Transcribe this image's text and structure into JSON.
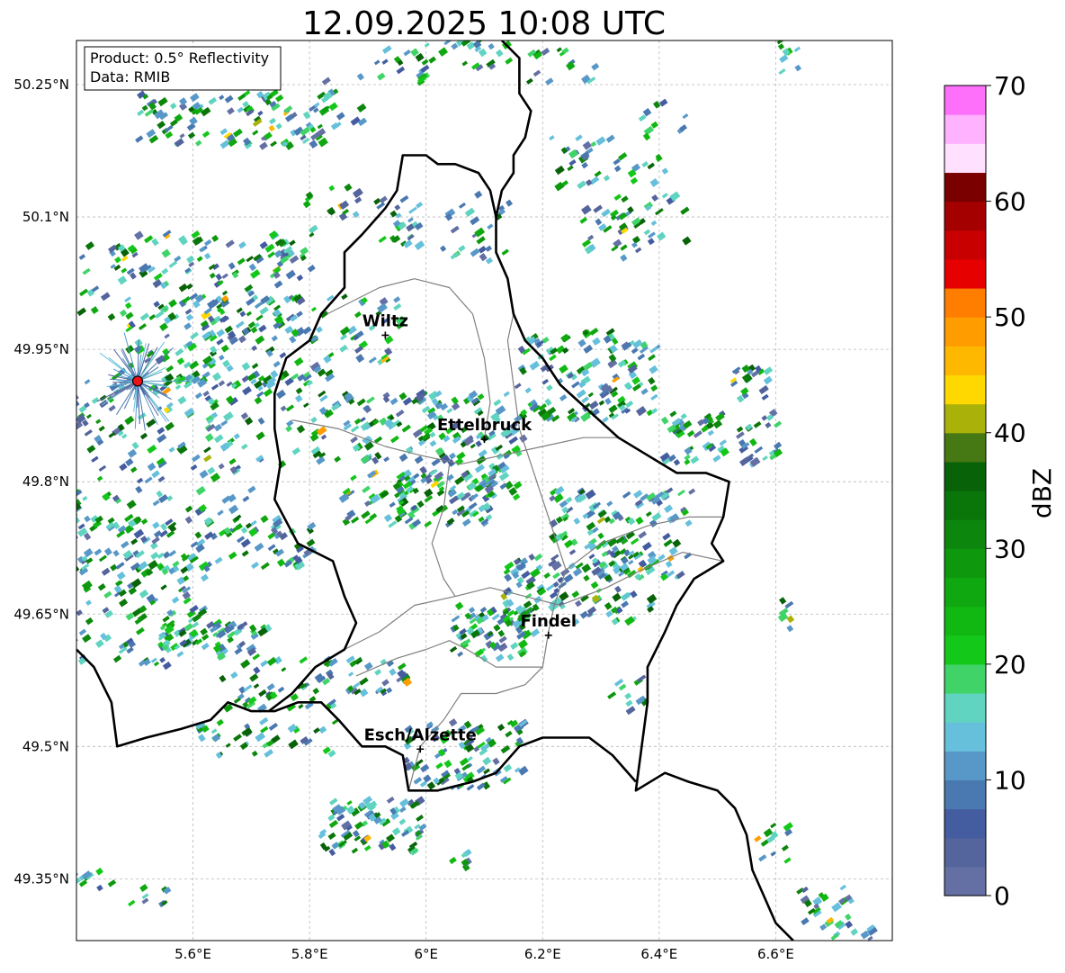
{
  "title": "12.09.2025 10:08 UTC",
  "info_box": {
    "product": "Product: 0.5° Reflectivity",
    "data": "Data: RMIB"
  },
  "map_extent": {
    "lon_min": 5.4,
    "lon_max": 6.8,
    "lat_min": 49.28,
    "lat_max": 50.3
  },
  "lon_ticks": [
    {
      "value": 5.6,
      "label": "5.6°E"
    },
    {
      "value": 5.8,
      "label": "5.8°E"
    },
    {
      "value": 6.0,
      "label": "6°E"
    },
    {
      "value": 6.2,
      "label": "6.2°E"
    },
    {
      "value": 6.4,
      "label": "6.4°E"
    },
    {
      "value": 6.6,
      "label": "6.6°E"
    }
  ],
  "lat_ticks": [
    {
      "value": 50.25,
      "label": "50.25°N"
    },
    {
      "value": 50.1,
      "label": "50.1°N"
    },
    {
      "value": 49.95,
      "label": "49.95°N"
    },
    {
      "value": 49.8,
      "label": "49.8°N"
    },
    {
      "value": 49.65,
      "label": "49.65°N"
    },
    {
      "value": 49.5,
      "label": "49.5°N"
    },
    {
      "value": 49.35,
      "label": "49.35°N"
    }
  ],
  "cities": [
    {
      "name": "Wiltz",
      "lon": 5.93,
      "lat": 49.966
    },
    {
      "name": "Ettelbruck",
      "lon": 6.1,
      "lat": 49.848
    },
    {
      "name": "Findel",
      "lon": 6.21,
      "lat": 49.626
    },
    {
      "name": "Esch/Alzette",
      "lon": 5.99,
      "lat": 49.497
    }
  ],
  "radar_site": {
    "lon": 5.505,
    "lat": 49.914,
    "color": "#e8141a"
  },
  "colorbar": {
    "label": "dBZ",
    "min": 0,
    "max": 70,
    "step": 2.5,
    "tick_labels": [
      "0",
      "10",
      "20",
      "30",
      "40",
      "50",
      "60",
      "70"
    ],
    "colors": [
      "#6470a4",
      "#54649c",
      "#445ca0",
      "#4a78b0",
      "#5898c8",
      "#66c0dc",
      "#60d4c0",
      "#40d468",
      "#14c81a",
      "#12b812",
      "#10a810",
      "#0e980e",
      "#0c860c",
      "#0a760a",
      "#086208",
      "#467814",
      "#aab20a",
      "#ffd800",
      "#ffb800",
      "#ff9c00",
      "#ff7e00",
      "#e60000",
      "#c80000",
      "#a40000",
      "#7a0000",
      "#ffe0ff",
      "#ffb2ff",
      "#ff70fa",
      "#ea36ea"
    ]
  },
  "borders": {
    "country": [
      [
        [
          6.13,
          50.3
        ],
        [
          6.16,
          50.28
        ],
        [
          6.16,
          50.24
        ],
        [
          6.18,
          50.22
        ],
        [
          6.17,
          50.19
        ],
        [
          6.15,
          50.17
        ],
        [
          6.15,
          50.15
        ],
        [
          6.13,
          50.13
        ],
        [
          6.12,
          50.1
        ],
        [
          6.12,
          50.06
        ],
        [
          6.14,
          50.03
        ],
        [
          6.15,
          49.99
        ],
        [
          6.17,
          49.96
        ],
        [
          6.2,
          49.94
        ],
        [
          6.23,
          49.91
        ],
        [
          6.28,
          49.88
        ],
        [
          6.33,
          49.85
        ],
        [
          6.38,
          49.83
        ],
        [
          6.43,
          49.81
        ],
        [
          6.48,
          49.81
        ],
        [
          6.52,
          49.8
        ],
        [
          6.51,
          49.76
        ],
        [
          6.49,
          49.73
        ],
        [
          6.51,
          49.71
        ],
        [
          6.46,
          49.69
        ],
        [
          6.43,
          49.66
        ],
        [
          6.41,
          49.63
        ],
        [
          6.38,
          49.59
        ],
        [
          6.38,
          49.55
        ],
        [
          6.37,
          49.5
        ],
        [
          6.36,
          49.45
        ],
        [
          6.41,
          49.47
        ],
        [
          6.45,
          49.46
        ],
        [
          6.5,
          49.45
        ],
        [
          6.53,
          49.43
        ],
        [
          6.55,
          49.4
        ],
        [
          6.56,
          49.36
        ],
        [
          6.58,
          49.33
        ],
        [
          6.6,
          49.3
        ],
        [
          6.63,
          49.28
        ]
      ],
      [
        [
          5.4,
          49.61
        ],
        [
          5.43,
          49.59
        ],
        [
          5.46,
          49.55
        ],
        [
          5.47,
          49.5
        ],
        [
          5.52,
          49.51
        ],
        [
          5.58,
          49.52
        ],
        [
          5.63,
          49.53
        ],
        [
          5.66,
          49.55
        ],
        [
          5.7,
          49.54
        ],
        [
          5.74,
          49.54
        ],
        [
          5.78,
          49.55
        ],
        [
          5.82,
          49.55
        ],
        [
          5.85,
          49.53
        ],
        [
          5.89,
          49.5
        ],
        [
          5.93,
          49.5
        ],
        [
          5.96,
          49.49
        ],
        [
          5.97,
          49.45
        ],
        [
          6.02,
          49.45
        ],
        [
          6.08,
          49.46
        ],
        [
          6.12,
          49.47
        ],
        [
          6.16,
          49.5
        ],
        [
          6.2,
          49.51
        ],
        [
          6.24,
          49.51
        ],
        [
          6.28,
          49.51
        ],
        [
          6.32,
          49.49
        ],
        [
          6.36,
          49.46
        ]
      ],
      [
        [
          5.73,
          49.54
        ],
        [
          5.77,
          49.56
        ],
        [
          5.81,
          49.59
        ],
        [
          5.86,
          49.61
        ],
        [
          5.88,
          49.64
        ],
        [
          5.86,
          49.67
        ],
        [
          5.84,
          49.71
        ],
        [
          5.78,
          49.73
        ],
        [
          5.74,
          49.78
        ],
        [
          5.75,
          49.82
        ],
        [
          5.74,
          49.86
        ],
        [
          5.74,
          49.9
        ],
        [
          5.76,
          49.94
        ],
        [
          5.8,
          49.96
        ],
        [
          5.82,
          49.99
        ],
        [
          5.86,
          50.02
        ],
        [
          5.86,
          50.06
        ],
        [
          5.89,
          50.08
        ],
        [
          5.93,
          50.11
        ],
        [
          5.95,
          50.13
        ],
        [
          5.96,
          50.17
        ],
        [
          6.0,
          50.17
        ],
        [
          6.02,
          50.16
        ],
        [
          6.05,
          50.16
        ],
        [
          6.09,
          50.15
        ],
        [
          6.11,
          50.13
        ],
        [
          6.12,
          50.1
        ]
      ]
    ],
    "canton": [
      [
        [
          5.97,
          49.45
        ],
        [
          5.99,
          49.5
        ],
        [
          6.03,
          49.53
        ],
        [
          6.06,
          49.56
        ],
        [
          6.12,
          49.56
        ],
        [
          6.17,
          49.57
        ],
        [
          6.2,
          49.59
        ],
        [
          6.21,
          49.63
        ],
        [
          6.22,
          49.66
        ],
        [
          6.24,
          49.7
        ],
        [
          6.22,
          49.74
        ],
        [
          6.19,
          49.8
        ],
        [
          6.16,
          49.86
        ],
        [
          6.15,
          49.91
        ],
        [
          6.14,
          49.96
        ],
        [
          6.15,
          49.99
        ]
      ],
      [
        [
          5.86,
          49.61
        ],
        [
          5.92,
          49.63
        ],
        [
          5.98,
          49.66
        ],
        [
          6.05,
          49.67
        ],
        [
          6.11,
          49.68
        ],
        [
          6.17,
          49.67
        ],
        [
          6.23,
          49.66
        ],
        [
          6.31,
          49.68
        ],
        [
          6.37,
          49.7
        ],
        [
          6.44,
          49.72
        ],
        [
          6.51,
          49.71
        ]
      ],
      [
        [
          5.77,
          49.87
        ],
        [
          5.85,
          49.86
        ],
        [
          5.93,
          49.84
        ],
        [
          5.99,
          49.83
        ],
        [
          6.06,
          49.82
        ],
        [
          6.13,
          49.83
        ],
        [
          6.2,
          49.84
        ],
        [
          6.27,
          49.85
        ],
        [
          6.33,
          49.85
        ]
      ],
      [
        [
          5.83,
          49.99
        ],
        [
          5.92,
          50.02
        ],
        [
          5.98,
          50.03
        ],
        [
          6.04,
          50.02
        ],
        [
          6.08,
          49.99
        ],
        [
          6.1,
          49.94
        ],
        [
          6.11,
          49.89
        ],
        [
          6.1,
          49.85
        ]
      ],
      [
        [
          5.88,
          49.58
        ],
        [
          5.95,
          49.6
        ],
        [
          6.0,
          49.61
        ],
        [
          6.04,
          49.62
        ],
        [
          6.07,
          49.61
        ],
        [
          6.12,
          49.59
        ],
        [
          6.2,
          49.59
        ]
      ],
      [
        [
          6.04,
          49.82
        ],
        [
          6.03,
          49.77
        ],
        [
          6.01,
          49.73
        ],
        [
          6.03,
          49.69
        ],
        [
          6.05,
          49.67
        ]
      ],
      [
        [
          6.24,
          49.7
        ],
        [
          6.3,
          49.73
        ],
        [
          6.38,
          49.75
        ],
        [
          6.45,
          49.76
        ],
        [
          6.51,
          49.76
        ]
      ]
    ]
  }
}
